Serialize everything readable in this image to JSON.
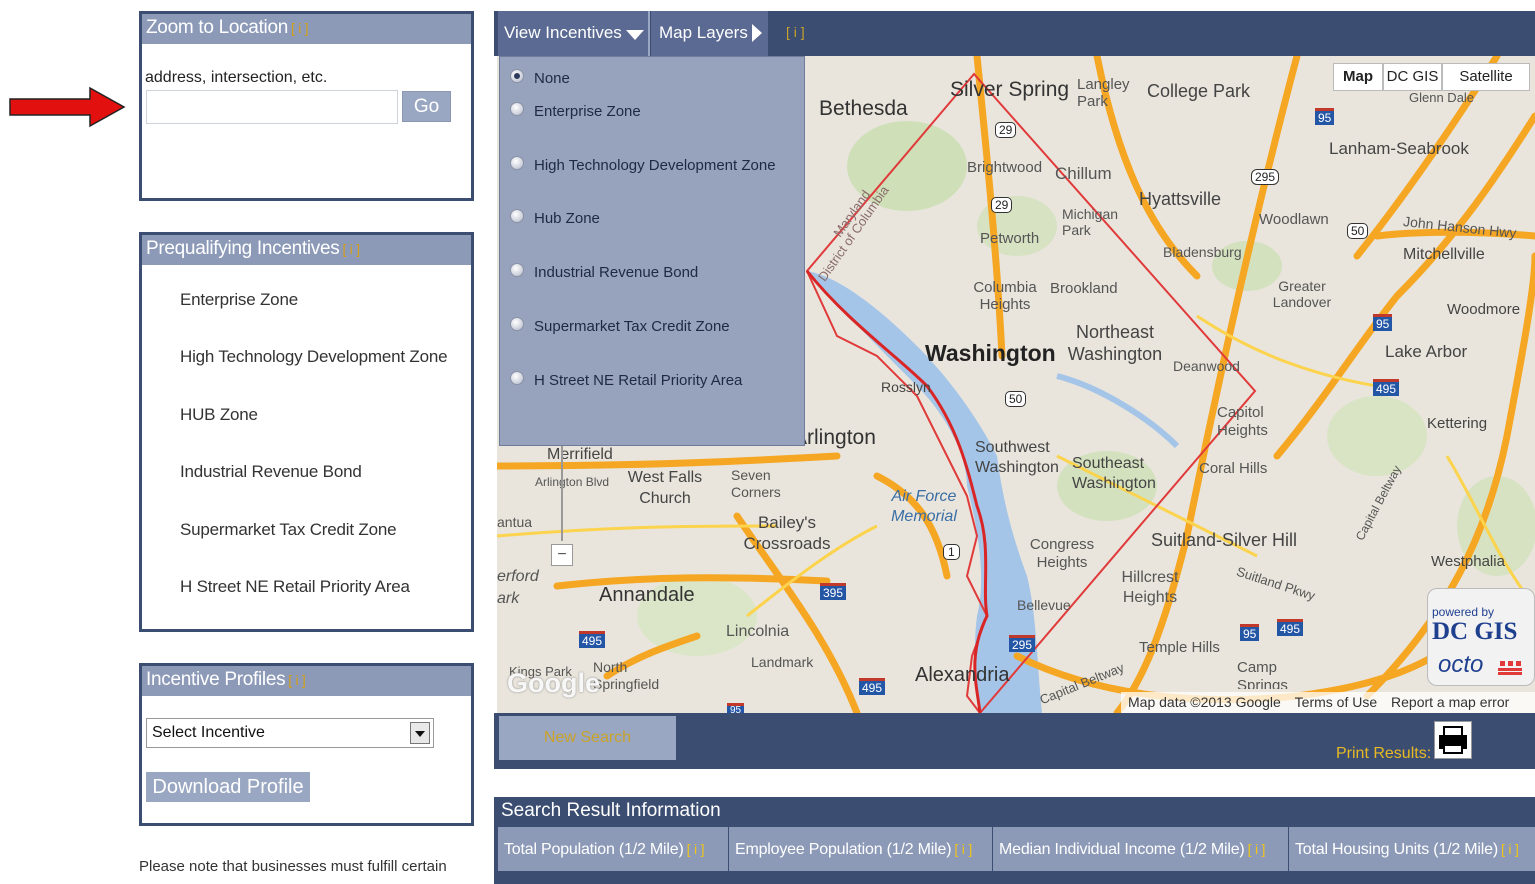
{
  "zoom_panel": {
    "title": "Zoom to Location",
    "info": "[ i ]",
    "label": "address, intersection, etc.",
    "input_value": "",
    "go_label": "Go"
  },
  "incentives_panel": {
    "title": "Prequalifying Incentives",
    "info": "[ i ]",
    "items": [
      "Enterprise Zone",
      "High Technology Development Zone",
      "HUB Zone",
      "Industrial Revenue Bond",
      "Supermarket Tax Credit Zone",
      "H Street NE Retail Priority Area"
    ]
  },
  "profiles_panel": {
    "title": "Incentive Profiles",
    "info": "[ i ]",
    "select_value": "Select Incentive",
    "download_label": "Download Profile"
  },
  "footnote": "Please note that businesses must fulfill certain",
  "toolbar": {
    "view_incentives": "View Incentives",
    "map_layers": "Map Layers",
    "info": "[ i ]"
  },
  "dropdown": {
    "options": [
      "None",
      "Enterprise Zone",
      "High Technology Development Zone",
      "Hub Zone",
      "Industrial Revenue Bond",
      "Supermarket Tax Credit Zone",
      "H Street NE Retail Priority Area"
    ],
    "selected": "None"
  },
  "map_types": [
    "Map",
    "DC GIS",
    "Satellite"
  ],
  "map_labels": {
    "silver_spring": "Silver Spring",
    "langley_park": "Langley Park",
    "college_park": "College Park",
    "bethesda": "Bethesda",
    "glenn_dale": "Glenn Dale",
    "lanham": "Lanham-Seabrook",
    "brightwood": "Brightwood",
    "chillum": "Chillum",
    "hyattsville": "Hyattsville",
    "michigan_park": "Michigan Park",
    "petworth": "Petworth",
    "bladensburg": "Bladensburg",
    "woodlawn": "Woodlawn",
    "john_hanson": "John Hanson Hwy",
    "mitchellville": "Mitchellville",
    "columbia_heights": "Columbia Heights",
    "brookland": "Brookland",
    "greater_landover": "Greater Landover",
    "woodmore": "Woodmore",
    "maryland": "Maryland",
    "dc": "District of Columbia",
    "northeast_washington": "Northeast Washington",
    "washington": "Washington",
    "deanwood": "Deanwood",
    "lake_arbor": "Lake Arbor",
    "rosslyn": "Rosslyn",
    "capitol_heights": "Capitol Heights",
    "kettering": "Kettering",
    "arlington": "Arlington",
    "southwest_washington": "Southwest Washington",
    "southeast_washington": "Southeast Washington",
    "coral_hills": "Coral Hills",
    "merrifield": "Merrifield",
    "arlington_blvd": "Arlington Blvd",
    "west_falls_church": "West Falls Church",
    "seven_corners": "Seven Corners",
    "air_force": "Air Force Memorial",
    "capital_beltway": "Capital Beltway",
    "baileys": "Bailey's Crossroads",
    "congress_heights": "Congress Heights",
    "suitland": "Suitland-Silver Hill",
    "westphalia": "Westphalia",
    "hillcrest": "Hillcrest Heights",
    "suitland_pkwy": "Suitland Pkwy",
    "annandale": "Annandale",
    "bellevue": "Bellevue",
    "lincolnia": "Lincolnia",
    "temple_hills": "Temple Hills",
    "landmark": "Landmark",
    "kings_park": "Kings Park",
    "north_springfield": "North Springfield",
    "alexandria": "Alexandria",
    "camp_springs": "Camp Springs",
    "capital_beltway_2": "Capital Beltway",
    "mantua": "antua",
    "fairfax": "erford",
    "park": "ark"
  },
  "shields": [
    "29",
    "29",
    "295",
    "95",
    "50",
    "95",
    "50",
    "495",
    "1",
    "395",
    "495",
    "295",
    "95",
    "495",
    "495",
    "95"
  ],
  "map_footer": {
    "google": "Google",
    "data": "Map data ©2013 Google",
    "terms": "Terms of Use",
    "report": "Report a map error"
  },
  "dcgis": {
    "powered": "powered by",
    "brand": "DC GIS",
    "octo": "octo"
  },
  "zoom_out": "−",
  "new_search": "New Search",
  "print_results": "Print Results:",
  "results": {
    "title": "Search Result Information",
    "columns": [
      {
        "label": "Total Population (1/2 Mile)",
        "info": "[ i ]"
      },
      {
        "label": "Employee Population (1/2 Mile)",
        "info": "[ i ]"
      },
      {
        "label": "Median Individual Income (1/2 Mile)",
        "info": "[ i ]"
      },
      {
        "label": "Total Housing Units (1/2 Mile)",
        "info": "[ i ]"
      }
    ]
  },
  "colors": {
    "navy": "#3c4d72",
    "header": "#8c9ab8",
    "info": "#f0c419",
    "arrow": "#e31010"
  }
}
